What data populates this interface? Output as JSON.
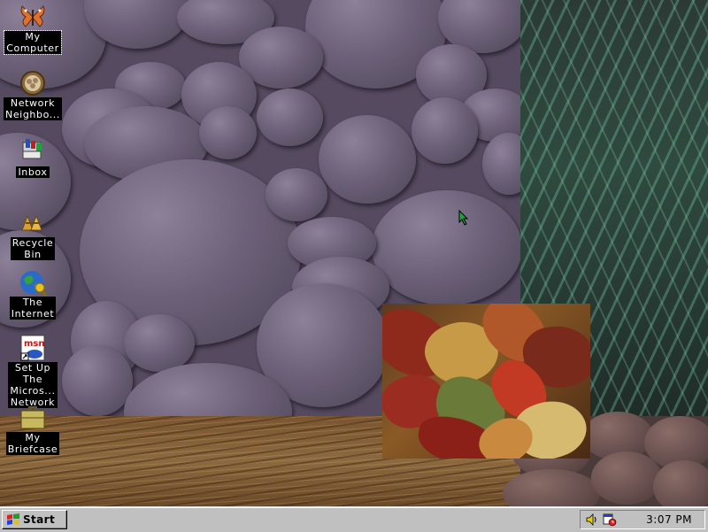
{
  "desktop": {
    "icons": [
      {
        "label": "My\nComputer",
        "icon": "butterfly-icon"
      },
      {
        "label": "Network\nNeighbo...",
        "icon": "network-neighborhood-icon"
      },
      {
        "label": "Inbox",
        "icon": "inbox-icon"
      },
      {
        "label": "Recycle\nBin",
        "icon": "recycle-bin-icon"
      },
      {
        "label": "The\nInternet",
        "icon": "internet-globe-icon"
      },
      {
        "label": "Set Up\nThe\nMicros...\nNetwork",
        "icon": "msn-setup-icon"
      },
      {
        "label": "My\nBriefcase",
        "icon": "briefcase-icon"
      }
    ]
  },
  "taskbar": {
    "start_label": "Start",
    "clock": "3:07 PM",
    "tray_icons": [
      "volume-icon",
      "scheduler-icon"
    ]
  },
  "colors": {
    "taskbar": "#c0c0c0",
    "icon_label_bg": "#000000",
    "icon_label_text": "#ffffff"
  }
}
